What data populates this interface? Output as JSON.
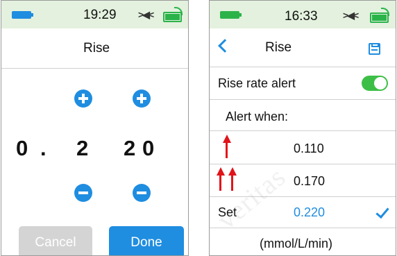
{
  "left_screen": {
    "status_time": "19:29",
    "title": "Rise",
    "digits": [
      "0",
      ".",
      "2",
      "2",
      "0"
    ],
    "cancel_label": "Cancel",
    "done_label": "Done"
  },
  "right_screen": {
    "status_time": "16:33",
    "title": "Rise",
    "toggle_label": "Rise rate alert",
    "toggle_on": true,
    "alert_when_label": "Alert when:",
    "single_arrow_value": "0.110",
    "double_arrow_value": "0.170",
    "set_label": "Set",
    "set_value": "0.220",
    "unit": "(mmol/L/min)"
  },
  "watermark_text": "veritas",
  "colors": {
    "accent_blue": "#1f8de0",
    "status_bar_bg": "#e3f1de",
    "toggle_green": "#3dbf47",
    "alert_red": "#e0141a",
    "cancel_gray": "#d4d4d4"
  }
}
